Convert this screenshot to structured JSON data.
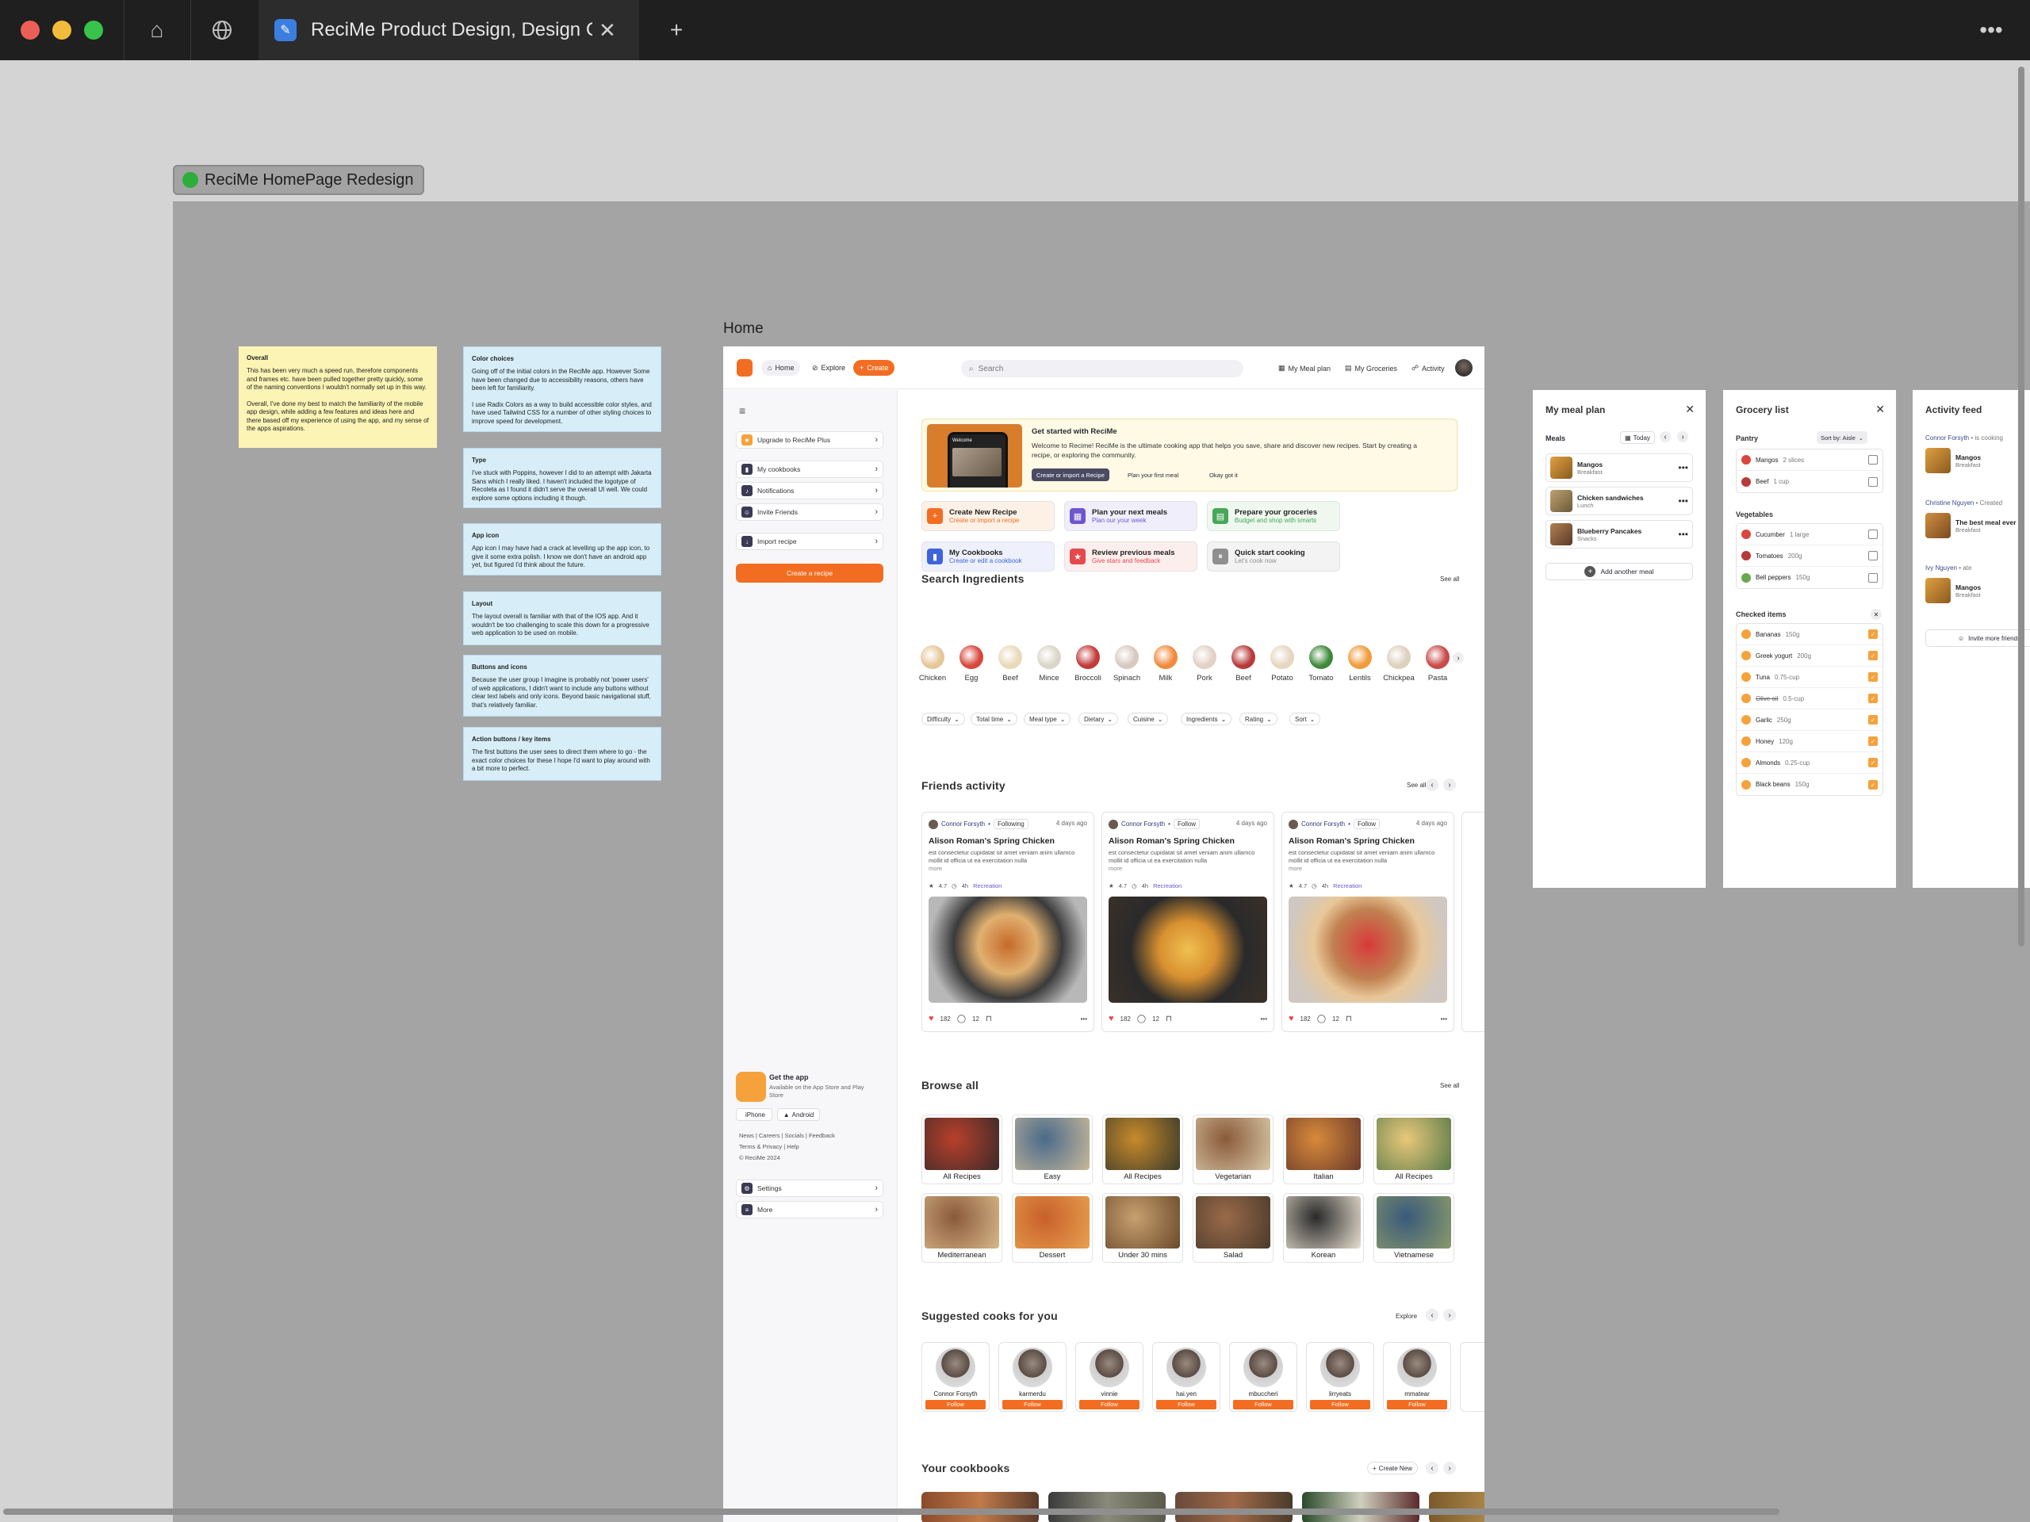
{
  "browser": {
    "tab_title": "ReciMe Product Design, Design Ch",
    "icons": [
      "home-icon",
      "globe-icon",
      "close-icon",
      "plus-icon",
      "more-icon"
    ]
  },
  "canvas": {
    "frame_label": "ReciMe HomePage Redesign",
    "home_frame_title": "Home"
  },
  "notes": [
    {
      "title": "Overall",
      "body": "This has been very much a speed run, therefore components and frames etc. have been pulled together pretty quickly, some of the naming conventions I wouldn't normally set up in this way.\n\nOverall, I've done my best to match the familiarity of the mobile app design, while adding a few features and ideas here and there based off my experience of using the app, and my sense of the apps aspirations."
    },
    {
      "title": "Color choices",
      "body": "Going off of the initial colors in the ReciMe app. However Some have been changed due to accessibility reasons, others have been left for familiarity.\n\nI use Radix Colors as a way to build accessible color styles, and have used Tailwind CSS for a number of other styling choices to improve speed for development."
    },
    {
      "title": "Type",
      "body": "I've stuck with Poppins, however I did to an attempt with Jakarta Sans which I really liked. I haven't included the logotype of Recoleta as I found it didn't serve the overall UI well. We could explore some options including it though."
    },
    {
      "title": "App icon",
      "body": "App icon I may have had a crack at levelling up the app icon, to give it some extra polish. I know we don't have an android app yet, but figured I'd think about the future."
    },
    {
      "title": "Layout",
      "body": "The layout overall is familiar with that of the IOS app. And it wouldn't be too challenging to scale this down for a progressive web application to be used on mobile."
    },
    {
      "title": "Buttons and icons",
      "body": "Because the user group I imagine is probably not 'power users' of web applications, I didn't want to include any buttons without clear text labels and only icons. Beyond basic navigational stuff, that's relatively familiar."
    },
    {
      "title": "Action buttons / key items",
      "body": "The first buttons the user sees to direct them where to go - the exact color choices for these I hope I'd want to play around with a bit more to perfect."
    }
  ],
  "topbar": {
    "home": "Home",
    "explore": "Explore",
    "create": "Create",
    "search_placeholder": "Search",
    "meal_plan": "My Meal plan",
    "groceries": "My Groceries",
    "activity": "Activity"
  },
  "sidebar": {
    "items": [
      "Upgrade to ReciMe Plus",
      "My cookbooks",
      "Notifications",
      "Invite Friends",
      "Import recipe"
    ],
    "create_button": "Create a recipe",
    "get_app_title": "Get the app",
    "get_app_sub": "Available on the App Store and Play Store",
    "iphone": "iPhone",
    "android": "Android",
    "footer_links_1": "News | Careers | Socials | Feedback",
    "footer_links_2": "Terms & Privacy | Help",
    "copyright": "© ReciMe 2024",
    "settings": "Settings",
    "more": "More"
  },
  "banner": {
    "title": "Get started with ReciMe",
    "body": "Welcome to Recime! ReciMe is the ultimate cooking app that helps you save, share and discover new recipes. Start by creating a recipe, or exploring the community.",
    "primary": "Create or import a Recipe",
    "secondary": "Plan your first meal",
    "dismiss": "Okay got it",
    "phone_text": "Welcome"
  },
  "quick_actions": [
    {
      "title": "Create New Recipe",
      "sub": "Create or import a recipe",
      "color": "#f26d21",
      "tint": "#fdf1e6"
    },
    {
      "title": "Plan your next meals",
      "sub": "Plan our your week",
      "color": "#6e56cf",
      "tint": "#f1eefc"
    },
    {
      "title": "Prepare your groceries",
      "sub": "Budget and shop with smarts",
      "color": "#46a758",
      "tint": "#eef8ee"
    },
    {
      "title": "My Cookbooks",
      "sub": "Create or edit a cookbook",
      "color": "#3e63dd",
      "tint": "#eef1fc"
    },
    {
      "title": "Review previous meals",
      "sub": "Give stars and feedback",
      "color": "#e5484d",
      "tint": "#fdeeee"
    },
    {
      "title": "Quick start cooking",
      "sub": "Let's cook now",
      "color": "#8f8f8f",
      "tint": "#f3f3f3"
    }
  ],
  "ingredients": {
    "title": "Search Ingredients",
    "see_all": "See all",
    "items": [
      "Chicken",
      "Egg",
      "Beef",
      "Mince",
      "Broccoli",
      "Spinach",
      "Milk",
      "Pork",
      "Beef",
      "Potato",
      "Tomato",
      "Lentils",
      "Chickpea",
      "Pasta"
    ],
    "filters": [
      "Difficulty",
      "Total time",
      "Meal type",
      "Dietary",
      "Cuisine",
      "Ingredients",
      "Rating",
      "Sort"
    ]
  },
  "friends": {
    "title": "Friends activity",
    "see_all": "See all",
    "cards": [
      {
        "user": "Connor Forsyth",
        "rel": "Following",
        "ago": "4 days ago",
        "title": "Alison Roman's Spring Chicken",
        "desc": "est consectetur cupidatat sit amet veniam anim ullamco mollit id officia ut ea exercitation nulla",
        "more": "more",
        "rating": "4.7",
        "time": "4h",
        "tag": "Recreation",
        "likes": "182",
        "comments": "12"
      },
      {
        "user": "Connor Forsyth",
        "rel": "Follow",
        "ago": "4 days ago",
        "title": "Alison Roman's Spring Chicken",
        "desc": "est consectetur cupidatat sit amet veniam anim ullamco mollit id officia ut ea exercitation nulla",
        "more": "more",
        "rating": "4.7",
        "time": "4h",
        "tag": "Recreation",
        "likes": "182",
        "comments": "12"
      },
      {
        "user": "Connor Forsyth",
        "rel": "Follow",
        "ago": "4 days ago",
        "title": "Alison Roman's Spring Chicken",
        "desc": "est consectetur cupidatat sit amet veniam anim ullamco mollit id officia ut ea exercitation nulla",
        "more": "more",
        "rating": "4.7",
        "time": "4h",
        "tag": "Recreation",
        "likes": "182",
        "comments": "12"
      }
    ]
  },
  "browse": {
    "title": "Browse all",
    "see_all": "See all",
    "row1": [
      "All Recipes",
      "Easy",
      "All Recipes",
      "Vegetarian",
      "Italian",
      "All Recipes"
    ],
    "row2": [
      "Mediterranean",
      "Dessert",
      "Under 30 mins",
      "Salad",
      "Korean",
      "Vietnamese"
    ]
  },
  "cooks": {
    "title": "Suggested cooks for you",
    "explore": "Explore",
    "follow": "Follow",
    "names": [
      "Connor Forsyth",
      "karmerdu",
      "vinnie",
      "hai.yen",
      "mbuccheri",
      "lirryeats",
      "mmatear"
    ]
  },
  "cookbooks": {
    "title": "Your cookbooks",
    "create": "Create New"
  },
  "meal_plan": {
    "title": "My meal plan",
    "meals_label": "Meals",
    "today": "Today",
    "items": [
      {
        "name": "Mangos",
        "type": "Breakfast"
      },
      {
        "name": "Chicken sandwiches",
        "type": "Lunch"
      },
      {
        "name": "Blueberry Pancakes",
        "type": "Snacks"
      }
    ],
    "add": "Add another meal"
  },
  "grocery": {
    "title": "Grocery list",
    "sort": "Sort by: Aisle",
    "pantry_label": "Pantry",
    "pantry": [
      {
        "name": "Mangos",
        "qty": "2 slices"
      },
      {
        "name": "Beef",
        "qty": "1 cup"
      }
    ],
    "veg_label": "Vegetables",
    "veg": [
      {
        "name": "Cucumber",
        "qty": "1 large"
      },
      {
        "name": "Tomatoes",
        "qty": "200g"
      },
      {
        "name": "Bell peppers",
        "qty": "150g"
      }
    ],
    "checked_label": "Checked items",
    "checked": [
      {
        "name": "Bananas",
        "qty": "150g",
        "strike": false
      },
      {
        "name": "Greek yogurt",
        "qty": "200g",
        "strike": false
      },
      {
        "name": "Tuna",
        "qty": "0.75-cup",
        "strike": false
      },
      {
        "name": "Olive oil",
        "qty": "0.5-cup",
        "strike": true
      },
      {
        "name": "Garlic",
        "qty": "250g",
        "strike": false
      },
      {
        "name": "Honey",
        "qty": "120g",
        "strike": false
      },
      {
        "name": "Almonds",
        "qty": "0.25-cup",
        "strike": false
      },
      {
        "name": "Black beans",
        "qty": "150g",
        "strike": false
      }
    ]
  },
  "activity": {
    "title": "Activity feed",
    "items": [
      {
        "who": "Connor Forsyth",
        "verb": "• is cooking",
        "name": "Mangos",
        "type": "Breakfast"
      },
      {
        "who": "Christine Nguyen",
        "verb": "• Created",
        "name": "The best meal ever",
        "type": "Breakfast"
      },
      {
        "who": "Ivy Nguyen",
        "verb": "• ate",
        "name": "Mangos",
        "type": "Breakfast"
      }
    ],
    "invite": "Invite more friends"
  }
}
